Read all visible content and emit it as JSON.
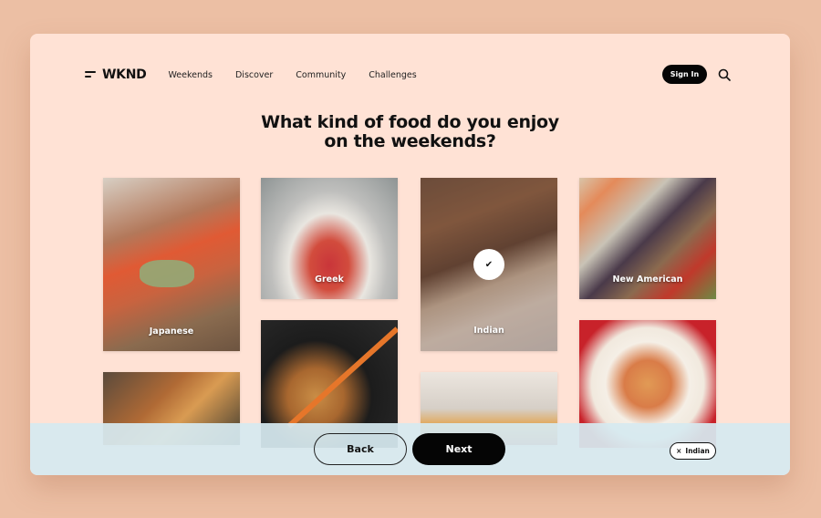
{
  "app": {
    "logo": "WKND"
  },
  "nav": {
    "links": [
      "Weekends",
      "Discover",
      "Community",
      "Challenges"
    ],
    "sign_in": "Sign In",
    "search_icon": "search-icon",
    "menu_icon": "menu-icon"
  },
  "question": {
    "line1": "What kind of food do you enjoy",
    "line2": "on the weekends?"
  },
  "tiles": [
    {
      "label": "Japanese",
      "selected": false
    },
    {
      "label": "Greek",
      "selected": false
    },
    {
      "label": "Indian",
      "selected": true,
      "check_icon": "✔"
    },
    {
      "label": "New American",
      "selected": false
    },
    {
      "label": "",
      "selected": false
    },
    {
      "label": "",
      "selected": false
    },
    {
      "label": "",
      "selected": false
    },
    {
      "label": "",
      "selected": false
    }
  ],
  "footer": {
    "back": "Back",
    "next": "Next",
    "selected_chips": [
      {
        "label": "Indian",
        "remove_icon": "×"
      }
    ]
  },
  "colors": {
    "background": "#ecbfa4",
    "panel": "#ffe2d5",
    "bottom_bar": "#d6e9f0",
    "primary": "#050505"
  }
}
